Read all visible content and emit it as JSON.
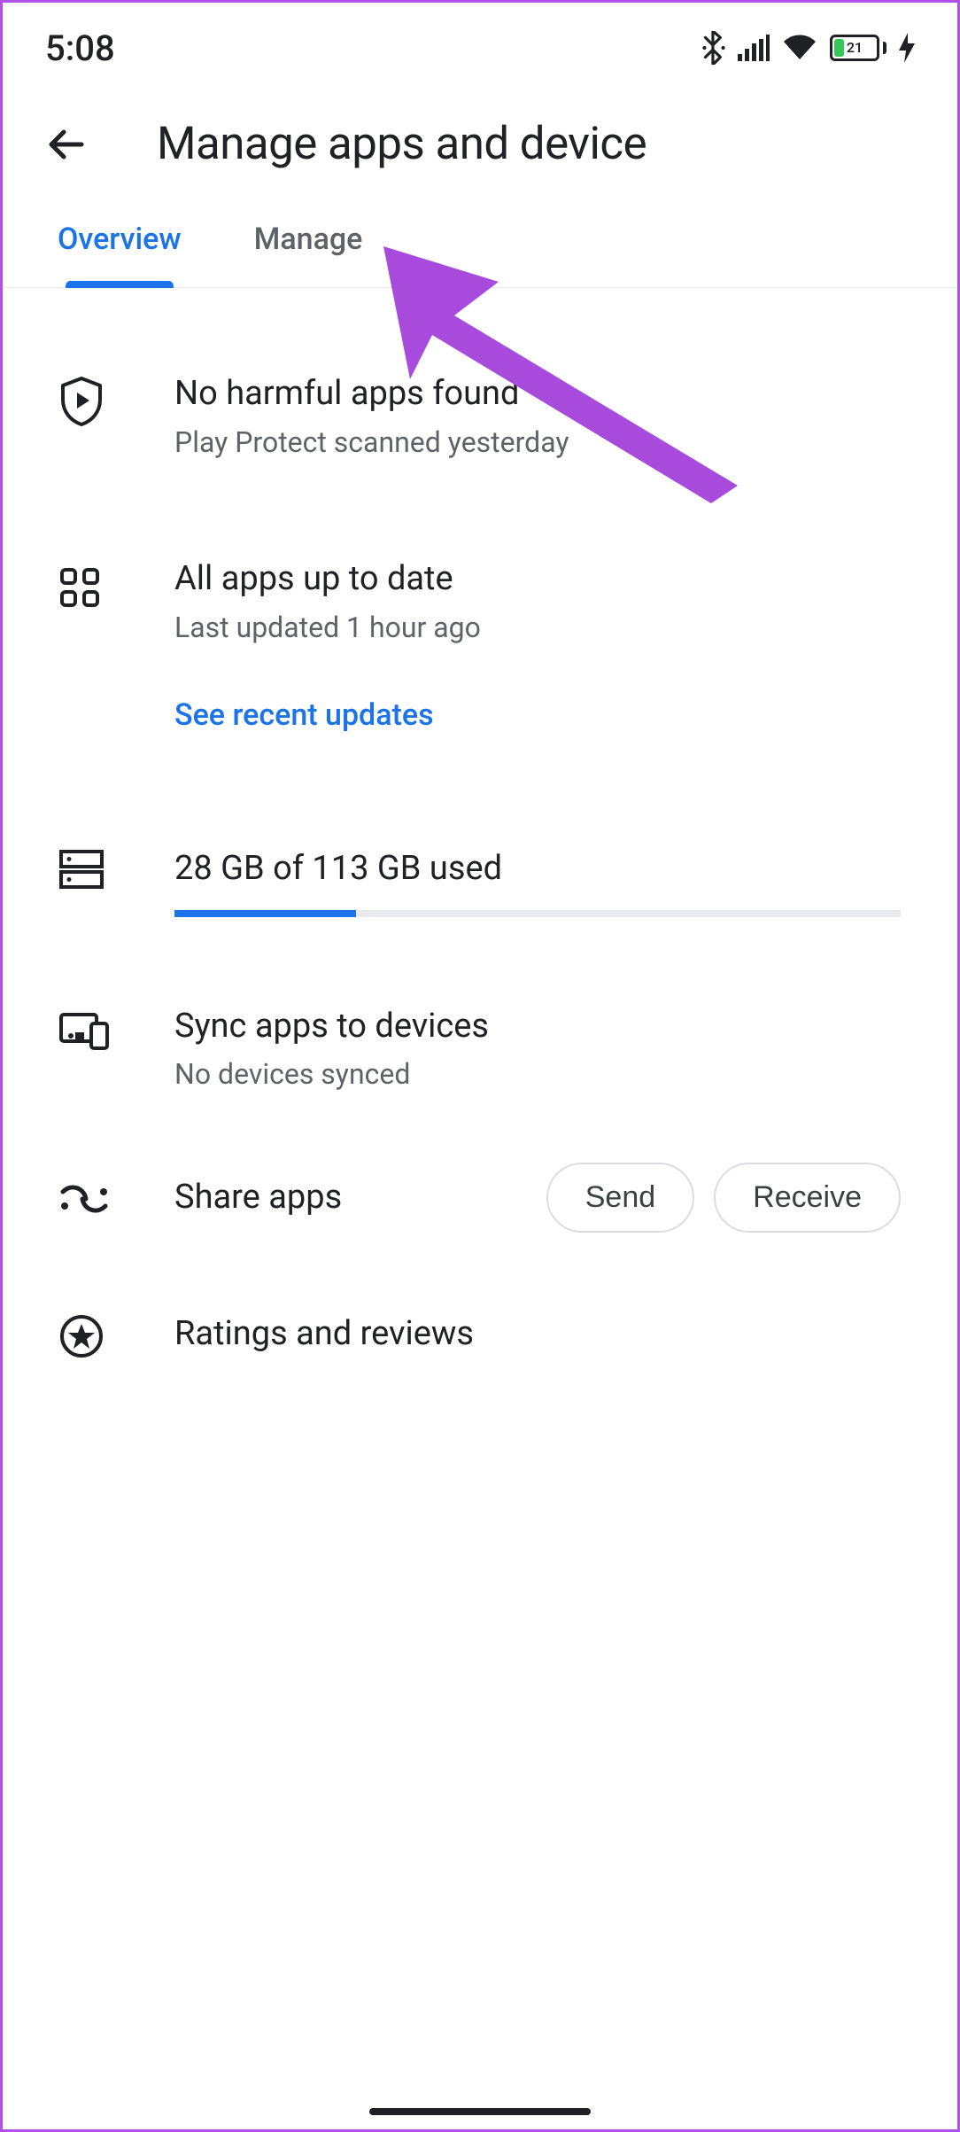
{
  "status": {
    "time": "5:08",
    "battery_pct": "21"
  },
  "header": {
    "title": "Manage apps and device"
  },
  "tabs": {
    "overview": "Overview",
    "manage": "Manage"
  },
  "protect": {
    "title": "No harmful apps found",
    "sub": "Play Protect scanned yesterday"
  },
  "updates": {
    "title": "All apps up to date",
    "sub": "Last updated 1 hour ago",
    "link": "See recent updates"
  },
  "storage": {
    "title": "28 GB of 113 GB used",
    "pct": 25
  },
  "sync": {
    "title": "Sync apps to devices",
    "sub": "No devices synced"
  },
  "share": {
    "label": "Share apps",
    "send": "Send",
    "receive": "Receive"
  },
  "ratings": {
    "title": "Ratings and reviews"
  }
}
